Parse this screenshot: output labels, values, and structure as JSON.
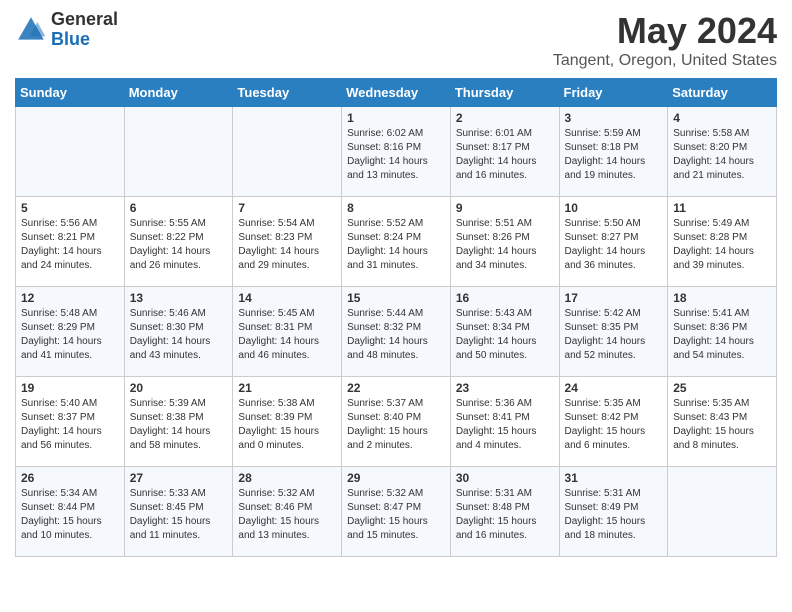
{
  "logo": {
    "general": "General",
    "blue": "Blue"
  },
  "title": "May 2024",
  "subtitle": "Tangent, Oregon, United States",
  "days_of_week": [
    "Sunday",
    "Monday",
    "Tuesday",
    "Wednesday",
    "Thursday",
    "Friday",
    "Saturday"
  ],
  "weeks": [
    [
      {
        "day": "",
        "info": ""
      },
      {
        "day": "",
        "info": ""
      },
      {
        "day": "",
        "info": ""
      },
      {
        "day": "1",
        "info": "Sunrise: 6:02 AM\nSunset: 8:16 PM\nDaylight: 14 hours\nand 13 minutes."
      },
      {
        "day": "2",
        "info": "Sunrise: 6:01 AM\nSunset: 8:17 PM\nDaylight: 14 hours\nand 16 minutes."
      },
      {
        "day": "3",
        "info": "Sunrise: 5:59 AM\nSunset: 8:18 PM\nDaylight: 14 hours\nand 19 minutes."
      },
      {
        "day": "4",
        "info": "Sunrise: 5:58 AM\nSunset: 8:20 PM\nDaylight: 14 hours\nand 21 minutes."
      }
    ],
    [
      {
        "day": "5",
        "info": "Sunrise: 5:56 AM\nSunset: 8:21 PM\nDaylight: 14 hours\nand 24 minutes."
      },
      {
        "day": "6",
        "info": "Sunrise: 5:55 AM\nSunset: 8:22 PM\nDaylight: 14 hours\nand 26 minutes."
      },
      {
        "day": "7",
        "info": "Sunrise: 5:54 AM\nSunset: 8:23 PM\nDaylight: 14 hours\nand 29 minutes."
      },
      {
        "day": "8",
        "info": "Sunrise: 5:52 AM\nSunset: 8:24 PM\nDaylight: 14 hours\nand 31 minutes."
      },
      {
        "day": "9",
        "info": "Sunrise: 5:51 AM\nSunset: 8:26 PM\nDaylight: 14 hours\nand 34 minutes."
      },
      {
        "day": "10",
        "info": "Sunrise: 5:50 AM\nSunset: 8:27 PM\nDaylight: 14 hours\nand 36 minutes."
      },
      {
        "day": "11",
        "info": "Sunrise: 5:49 AM\nSunset: 8:28 PM\nDaylight: 14 hours\nand 39 minutes."
      }
    ],
    [
      {
        "day": "12",
        "info": "Sunrise: 5:48 AM\nSunset: 8:29 PM\nDaylight: 14 hours\nand 41 minutes."
      },
      {
        "day": "13",
        "info": "Sunrise: 5:46 AM\nSunset: 8:30 PM\nDaylight: 14 hours\nand 43 minutes."
      },
      {
        "day": "14",
        "info": "Sunrise: 5:45 AM\nSunset: 8:31 PM\nDaylight: 14 hours\nand 46 minutes."
      },
      {
        "day": "15",
        "info": "Sunrise: 5:44 AM\nSunset: 8:32 PM\nDaylight: 14 hours\nand 48 minutes."
      },
      {
        "day": "16",
        "info": "Sunrise: 5:43 AM\nSunset: 8:34 PM\nDaylight: 14 hours\nand 50 minutes."
      },
      {
        "day": "17",
        "info": "Sunrise: 5:42 AM\nSunset: 8:35 PM\nDaylight: 14 hours\nand 52 minutes."
      },
      {
        "day": "18",
        "info": "Sunrise: 5:41 AM\nSunset: 8:36 PM\nDaylight: 14 hours\nand 54 minutes."
      }
    ],
    [
      {
        "day": "19",
        "info": "Sunrise: 5:40 AM\nSunset: 8:37 PM\nDaylight: 14 hours\nand 56 minutes."
      },
      {
        "day": "20",
        "info": "Sunrise: 5:39 AM\nSunset: 8:38 PM\nDaylight: 14 hours\nand 58 minutes."
      },
      {
        "day": "21",
        "info": "Sunrise: 5:38 AM\nSunset: 8:39 PM\nDaylight: 15 hours\nand 0 minutes."
      },
      {
        "day": "22",
        "info": "Sunrise: 5:37 AM\nSunset: 8:40 PM\nDaylight: 15 hours\nand 2 minutes."
      },
      {
        "day": "23",
        "info": "Sunrise: 5:36 AM\nSunset: 8:41 PM\nDaylight: 15 hours\nand 4 minutes."
      },
      {
        "day": "24",
        "info": "Sunrise: 5:35 AM\nSunset: 8:42 PM\nDaylight: 15 hours\nand 6 minutes."
      },
      {
        "day": "25",
        "info": "Sunrise: 5:35 AM\nSunset: 8:43 PM\nDaylight: 15 hours\nand 8 minutes."
      }
    ],
    [
      {
        "day": "26",
        "info": "Sunrise: 5:34 AM\nSunset: 8:44 PM\nDaylight: 15 hours\nand 10 minutes."
      },
      {
        "day": "27",
        "info": "Sunrise: 5:33 AM\nSunset: 8:45 PM\nDaylight: 15 hours\nand 11 minutes."
      },
      {
        "day": "28",
        "info": "Sunrise: 5:32 AM\nSunset: 8:46 PM\nDaylight: 15 hours\nand 13 minutes."
      },
      {
        "day": "29",
        "info": "Sunrise: 5:32 AM\nSunset: 8:47 PM\nDaylight: 15 hours\nand 15 minutes."
      },
      {
        "day": "30",
        "info": "Sunrise: 5:31 AM\nSunset: 8:48 PM\nDaylight: 15 hours\nand 16 minutes."
      },
      {
        "day": "31",
        "info": "Sunrise: 5:31 AM\nSunset: 8:49 PM\nDaylight: 15 hours\nand 18 minutes."
      },
      {
        "day": "",
        "info": ""
      }
    ]
  ]
}
